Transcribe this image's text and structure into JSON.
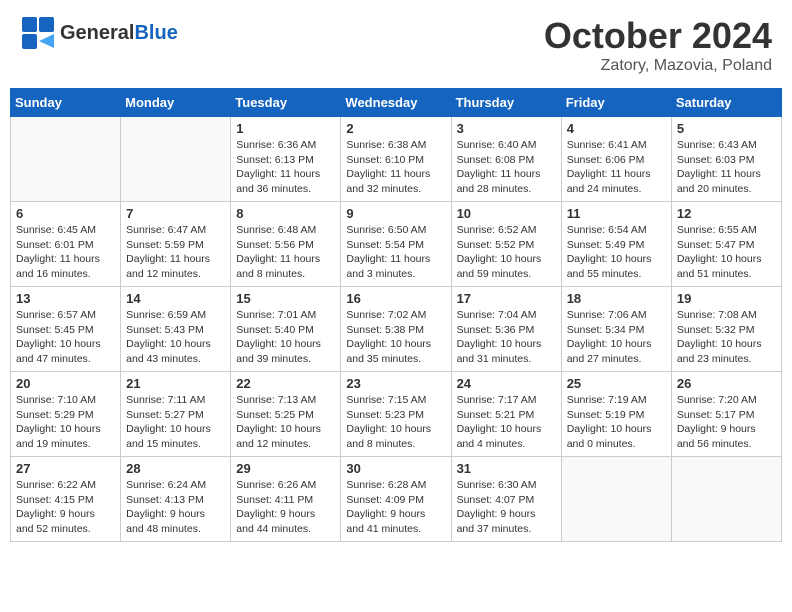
{
  "header": {
    "logo_general": "General",
    "logo_blue": "Blue",
    "month": "October 2024",
    "location": "Zatory, Mazovia, Poland"
  },
  "days_of_week": [
    "Sunday",
    "Monday",
    "Tuesday",
    "Wednesday",
    "Thursday",
    "Friday",
    "Saturday"
  ],
  "weeks": [
    [
      {
        "day": "",
        "info": ""
      },
      {
        "day": "",
        "info": ""
      },
      {
        "day": "1",
        "info": "Sunrise: 6:36 AM\nSunset: 6:13 PM\nDaylight: 11 hours and 36 minutes."
      },
      {
        "day": "2",
        "info": "Sunrise: 6:38 AM\nSunset: 6:10 PM\nDaylight: 11 hours and 32 minutes."
      },
      {
        "day": "3",
        "info": "Sunrise: 6:40 AM\nSunset: 6:08 PM\nDaylight: 11 hours and 28 minutes."
      },
      {
        "day": "4",
        "info": "Sunrise: 6:41 AM\nSunset: 6:06 PM\nDaylight: 11 hours and 24 minutes."
      },
      {
        "day": "5",
        "info": "Sunrise: 6:43 AM\nSunset: 6:03 PM\nDaylight: 11 hours and 20 minutes."
      }
    ],
    [
      {
        "day": "6",
        "info": "Sunrise: 6:45 AM\nSunset: 6:01 PM\nDaylight: 11 hours and 16 minutes."
      },
      {
        "day": "7",
        "info": "Sunrise: 6:47 AM\nSunset: 5:59 PM\nDaylight: 11 hours and 12 minutes."
      },
      {
        "day": "8",
        "info": "Sunrise: 6:48 AM\nSunset: 5:56 PM\nDaylight: 11 hours and 8 minutes."
      },
      {
        "day": "9",
        "info": "Sunrise: 6:50 AM\nSunset: 5:54 PM\nDaylight: 11 hours and 3 minutes."
      },
      {
        "day": "10",
        "info": "Sunrise: 6:52 AM\nSunset: 5:52 PM\nDaylight: 10 hours and 59 minutes."
      },
      {
        "day": "11",
        "info": "Sunrise: 6:54 AM\nSunset: 5:49 PM\nDaylight: 10 hours and 55 minutes."
      },
      {
        "day": "12",
        "info": "Sunrise: 6:55 AM\nSunset: 5:47 PM\nDaylight: 10 hours and 51 minutes."
      }
    ],
    [
      {
        "day": "13",
        "info": "Sunrise: 6:57 AM\nSunset: 5:45 PM\nDaylight: 10 hours and 47 minutes."
      },
      {
        "day": "14",
        "info": "Sunrise: 6:59 AM\nSunset: 5:43 PM\nDaylight: 10 hours and 43 minutes."
      },
      {
        "day": "15",
        "info": "Sunrise: 7:01 AM\nSunset: 5:40 PM\nDaylight: 10 hours and 39 minutes."
      },
      {
        "day": "16",
        "info": "Sunrise: 7:02 AM\nSunset: 5:38 PM\nDaylight: 10 hours and 35 minutes."
      },
      {
        "day": "17",
        "info": "Sunrise: 7:04 AM\nSunset: 5:36 PM\nDaylight: 10 hours and 31 minutes."
      },
      {
        "day": "18",
        "info": "Sunrise: 7:06 AM\nSunset: 5:34 PM\nDaylight: 10 hours and 27 minutes."
      },
      {
        "day": "19",
        "info": "Sunrise: 7:08 AM\nSunset: 5:32 PM\nDaylight: 10 hours and 23 minutes."
      }
    ],
    [
      {
        "day": "20",
        "info": "Sunrise: 7:10 AM\nSunset: 5:29 PM\nDaylight: 10 hours and 19 minutes."
      },
      {
        "day": "21",
        "info": "Sunrise: 7:11 AM\nSunset: 5:27 PM\nDaylight: 10 hours and 15 minutes."
      },
      {
        "day": "22",
        "info": "Sunrise: 7:13 AM\nSunset: 5:25 PM\nDaylight: 10 hours and 12 minutes."
      },
      {
        "day": "23",
        "info": "Sunrise: 7:15 AM\nSunset: 5:23 PM\nDaylight: 10 hours and 8 minutes."
      },
      {
        "day": "24",
        "info": "Sunrise: 7:17 AM\nSunset: 5:21 PM\nDaylight: 10 hours and 4 minutes."
      },
      {
        "day": "25",
        "info": "Sunrise: 7:19 AM\nSunset: 5:19 PM\nDaylight: 10 hours and 0 minutes."
      },
      {
        "day": "26",
        "info": "Sunrise: 7:20 AM\nSunset: 5:17 PM\nDaylight: 9 hours and 56 minutes."
      }
    ],
    [
      {
        "day": "27",
        "info": "Sunrise: 6:22 AM\nSunset: 4:15 PM\nDaylight: 9 hours and 52 minutes."
      },
      {
        "day": "28",
        "info": "Sunrise: 6:24 AM\nSunset: 4:13 PM\nDaylight: 9 hours and 48 minutes."
      },
      {
        "day": "29",
        "info": "Sunrise: 6:26 AM\nSunset: 4:11 PM\nDaylight: 9 hours and 44 minutes."
      },
      {
        "day": "30",
        "info": "Sunrise: 6:28 AM\nSunset: 4:09 PM\nDaylight: 9 hours and 41 minutes."
      },
      {
        "day": "31",
        "info": "Sunrise: 6:30 AM\nSunset: 4:07 PM\nDaylight: 9 hours and 37 minutes."
      },
      {
        "day": "",
        "info": ""
      },
      {
        "day": "",
        "info": ""
      }
    ]
  ]
}
